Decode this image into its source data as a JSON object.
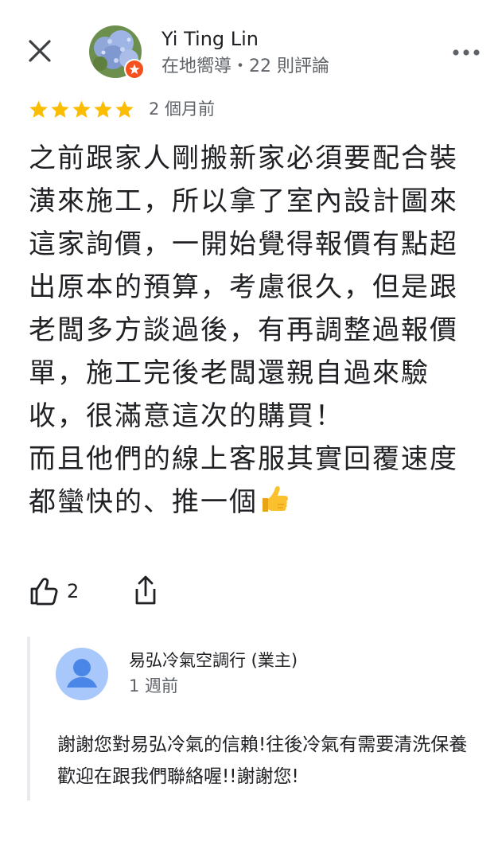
{
  "header": {
    "close_icon": "close-icon",
    "user_name": "Yi Ting Lin",
    "user_meta": "在地嚮導・22 則評論",
    "more_icon": "more-horizontal-icon"
  },
  "review": {
    "rating": 5,
    "rating_max": 5,
    "star_color": "#fbbc04",
    "time": "2 個月前",
    "text": "之前跟家人剛搬新家必須要配合裝潢來施工，所以拿了室內設計圖來這家詢價，一開始覺得報價有點超出原本的預算，考慮很久，但是跟老闆多方談過後，有再調整過報價單，施工完後老闆還親自過來驗收，很滿意這次的購買！\n而且他們的線上客服其實回覆速度都蠻快的、推一個",
    "trailing_emoji": "thumbs-up-emoji"
  },
  "actions": {
    "like_icon": "thumbs-up-icon",
    "like_count": "2",
    "share_icon": "share-icon"
  },
  "owner_reply": {
    "name": "易弘冷氣空調行 (業主)",
    "time": "1 週前",
    "text": "謝謝您對易弘冷氣的信賴!往後冷氣有需要清洗保養歡迎在跟我們聯絡喔!!謝謝您!",
    "avatar_icon": "person-icon",
    "avatar_color": "#a8c7fa"
  },
  "colors": {
    "badge": "#f4511e",
    "text_primary": "#202124",
    "text_secondary": "#5f6368"
  }
}
